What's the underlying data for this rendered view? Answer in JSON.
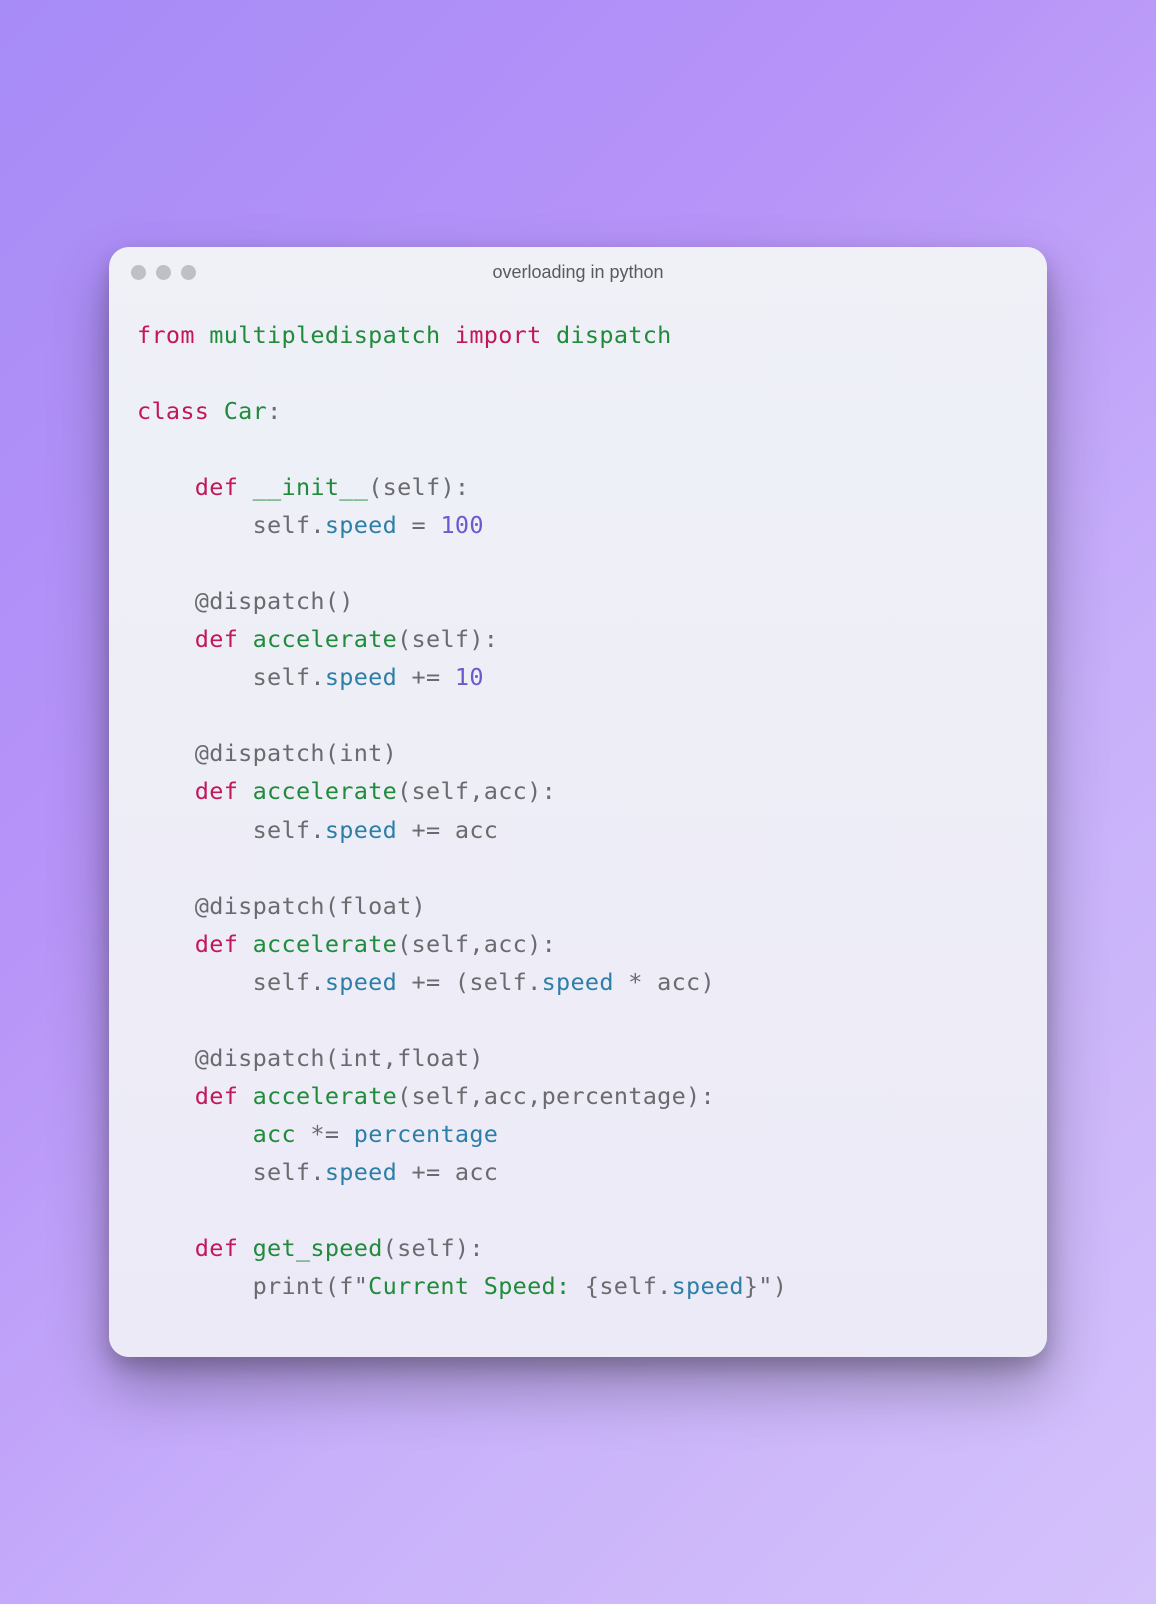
{
  "window": {
    "title": "overloading in python"
  },
  "code": {
    "lines": [
      [
        {
          "t": "from",
          "c": "kw"
        },
        {
          "t": " "
        },
        {
          "t": "multipledispatch",
          "c": "mod"
        },
        {
          "t": " "
        },
        {
          "t": "import",
          "c": "kw"
        },
        {
          "t": " "
        },
        {
          "t": "dispatch",
          "c": "mod"
        }
      ],
      [],
      [
        {
          "t": "class",
          "c": "kw"
        },
        {
          "t": " "
        },
        {
          "t": "Car",
          "c": "mod"
        },
        {
          "t": ":"
        }
      ],
      [],
      [
        {
          "t": "    "
        },
        {
          "t": "def",
          "c": "kw"
        },
        {
          "t": " "
        },
        {
          "t": "__init__",
          "c": "mod"
        },
        {
          "t": "(self):"
        }
      ],
      [
        {
          "t": "        self."
        },
        {
          "t": "speed",
          "c": "attr"
        },
        {
          "t": " = "
        },
        {
          "t": "100",
          "c": "num"
        }
      ],
      [],
      [
        {
          "t": "    @dispatch()"
        }
      ],
      [
        {
          "t": "    "
        },
        {
          "t": "def",
          "c": "kw"
        },
        {
          "t": " "
        },
        {
          "t": "accelerate",
          "c": "mod"
        },
        {
          "t": "(self):"
        }
      ],
      [
        {
          "t": "        self."
        },
        {
          "t": "speed",
          "c": "attr"
        },
        {
          "t": " += "
        },
        {
          "t": "10",
          "c": "num"
        }
      ],
      [],
      [
        {
          "t": "    @dispatch(int)"
        }
      ],
      [
        {
          "t": "    "
        },
        {
          "t": "def",
          "c": "kw"
        },
        {
          "t": " "
        },
        {
          "t": "accelerate",
          "c": "mod"
        },
        {
          "t": "(self,acc):"
        }
      ],
      [
        {
          "t": "        self."
        },
        {
          "t": "speed",
          "c": "attr"
        },
        {
          "t": " += acc"
        }
      ],
      [],
      [
        {
          "t": "    @dispatch(float)"
        }
      ],
      [
        {
          "t": "    "
        },
        {
          "t": "def",
          "c": "kw"
        },
        {
          "t": " "
        },
        {
          "t": "accelerate",
          "c": "mod"
        },
        {
          "t": "(self,acc):"
        }
      ],
      [
        {
          "t": "        self."
        },
        {
          "t": "speed",
          "c": "attr"
        },
        {
          "t": " += (self."
        },
        {
          "t": "speed",
          "c": "attr"
        },
        {
          "t": " * acc)"
        }
      ],
      [],
      [
        {
          "t": "    @dispatch(int,float)"
        }
      ],
      [
        {
          "t": "    "
        },
        {
          "t": "def",
          "c": "kw"
        },
        {
          "t": " "
        },
        {
          "t": "accelerate",
          "c": "mod"
        },
        {
          "t": "(self,acc,percentage):"
        }
      ],
      [
        {
          "t": "        "
        },
        {
          "t": "acc",
          "c": "mod"
        },
        {
          "t": " *= "
        },
        {
          "t": "percentage",
          "c": "attr"
        }
      ],
      [
        {
          "t": "        self."
        },
        {
          "t": "speed",
          "c": "attr"
        },
        {
          "t": " += acc"
        }
      ],
      [],
      [
        {
          "t": "    "
        },
        {
          "t": "def",
          "c": "kw"
        },
        {
          "t": " "
        },
        {
          "t": "get_speed",
          "c": "mod"
        },
        {
          "t": "(self):"
        }
      ],
      [
        {
          "t": "        print(f\""
        },
        {
          "t": "Current Speed: ",
          "c": "mod"
        },
        {
          "t": "{self."
        },
        {
          "t": "speed",
          "c": "attr"
        },
        {
          "t": "}\")"
        }
      ]
    ]
  }
}
